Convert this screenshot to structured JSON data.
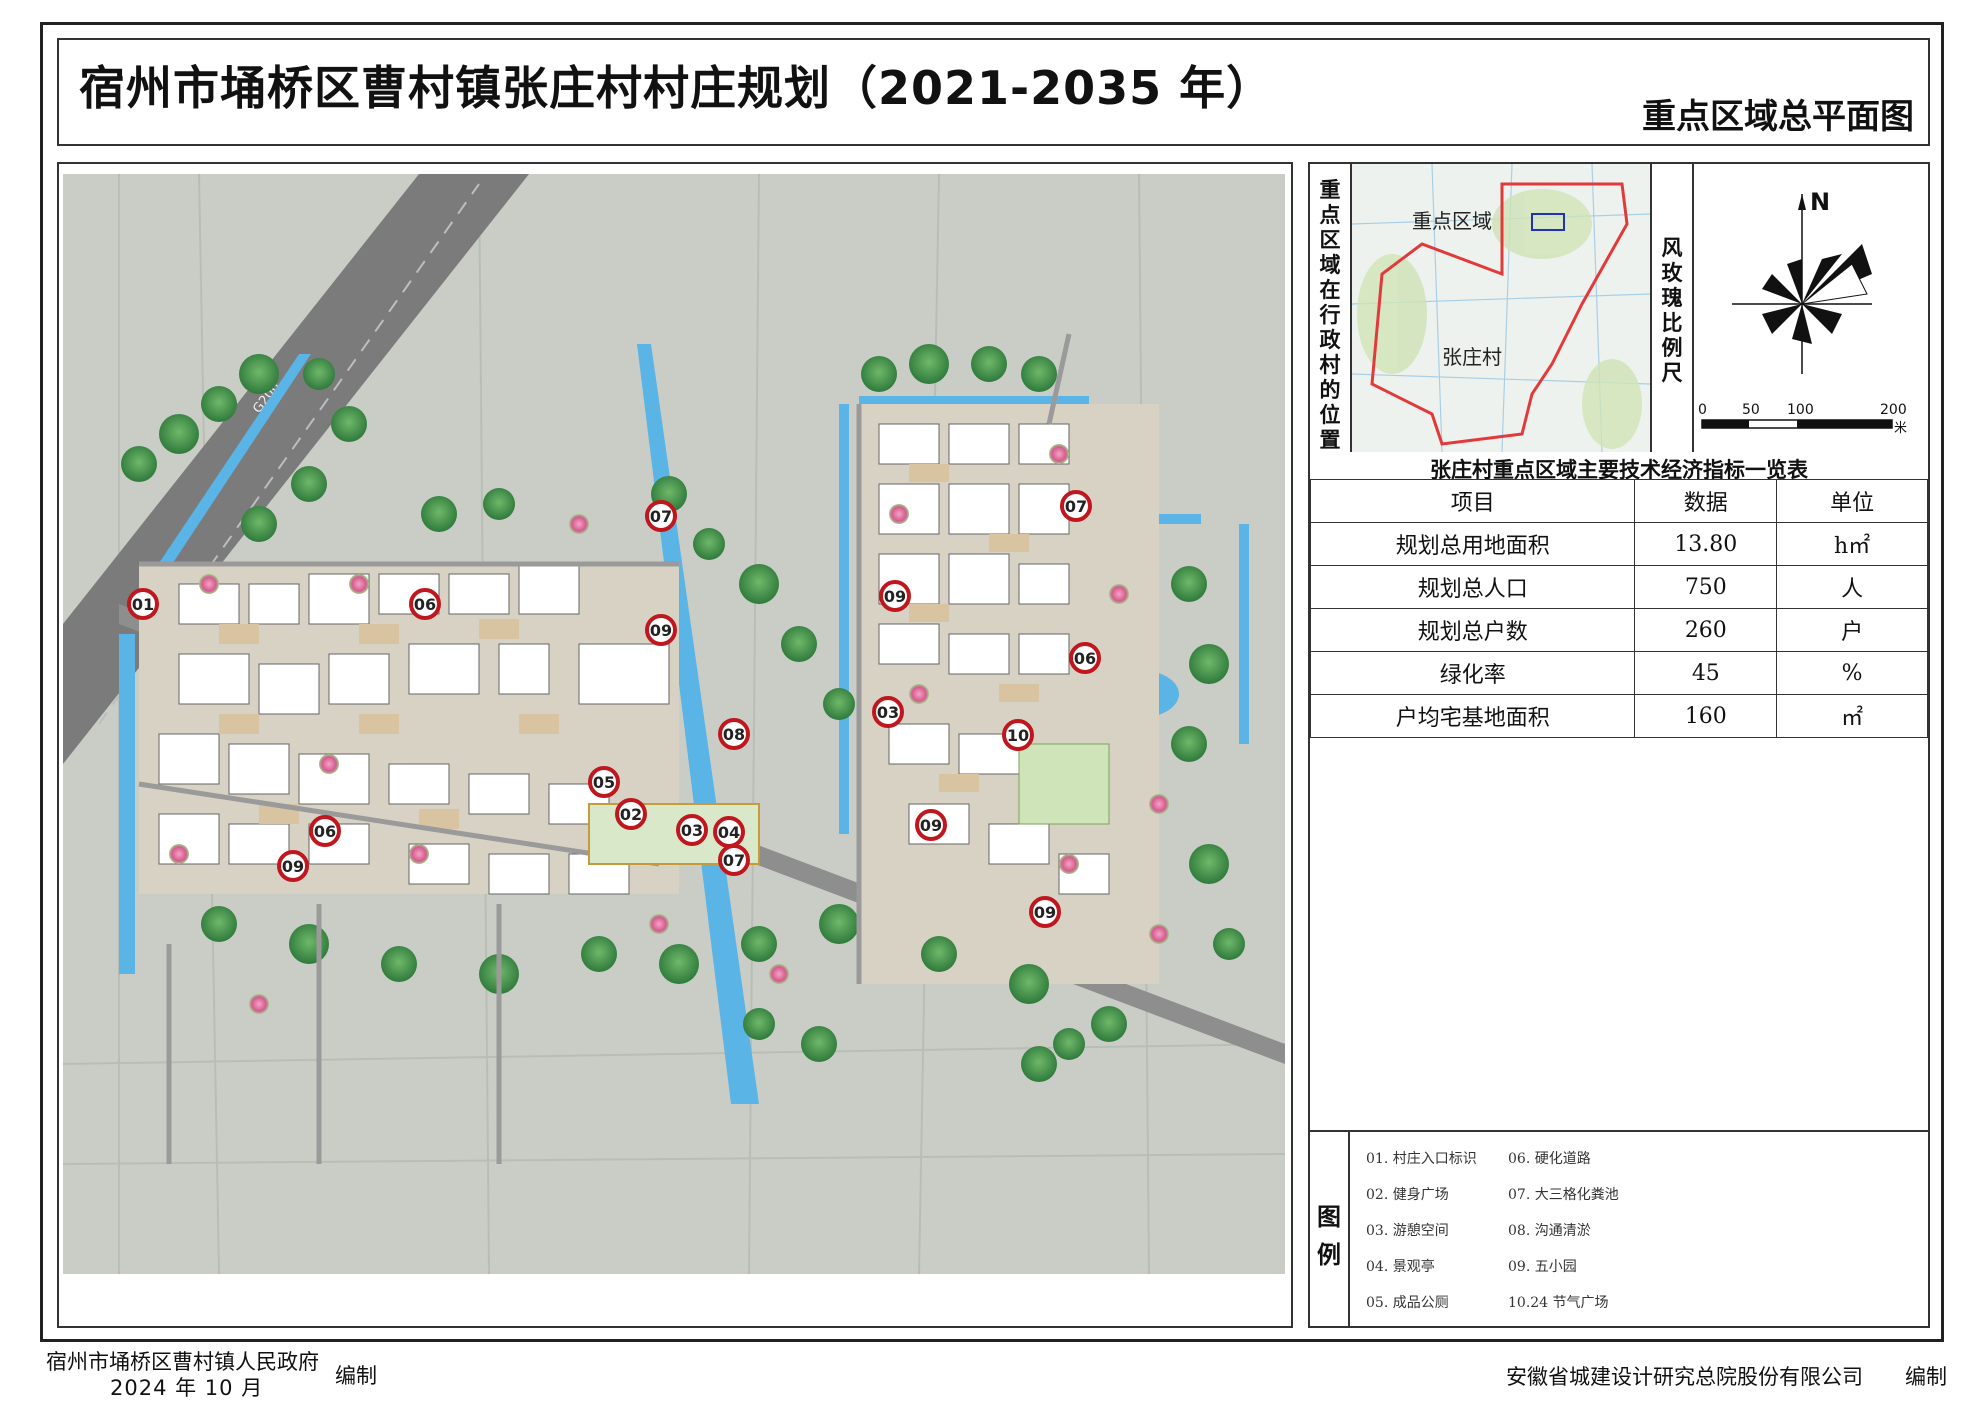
{
  "title": "宿州市埇桥区曹村镇张庄村村庄规划（2021-2035 年）",
  "subtitle": "重点区域总平面图",
  "location_map": {
    "side_label": "重点区域在行政村的位置",
    "focus_label": "重点区域",
    "village_label": "张庄村"
  },
  "wind_rose": {
    "side_label": "风玫瑰比例尺",
    "north": "N",
    "scale_ticks": [
      "0",
      "50",
      "100",
      "200"
    ],
    "scale_unit": "米"
  },
  "road_label": "G206",
  "tech_table": {
    "title": "张庄村重点区域主要技术经济指标一览表",
    "headers": [
      "项目",
      "数据",
      "单位"
    ],
    "rows": [
      [
        "规划总用地面积",
        "13.80",
        "h㎡"
      ],
      [
        "规划总人口",
        "750",
        "人"
      ],
      [
        "规划总户数",
        "260",
        "户"
      ],
      [
        "绿化率",
        "45",
        "%"
      ],
      [
        "户均宅基地面积",
        "160",
        "㎡"
      ]
    ]
  },
  "legend": {
    "title": "图例",
    "items": [
      "01. 村庄入口标识",
      "06. 硬化道路",
      "02. 健身广场",
      "07. 大三格化粪池",
      "03. 游憩空间",
      "08. 沟通清淤",
      "04. 景观亭",
      "09. 五小园",
      "05. 成品公厕",
      "10.24 节气广场"
    ]
  },
  "markers": [
    "01",
    "06",
    "07",
    "09",
    "08",
    "05",
    "02",
    "03",
    "04",
    "07",
    "06",
    "09",
    "07",
    "09",
    "06",
    "03",
    "10",
    "09",
    "09"
  ],
  "footer": {
    "left_org": "宿州市埇桥区曹村镇人民政府",
    "date": "2024 年 10 月",
    "left_edit": "编制",
    "right_org": "安徽省城建设计研究总院股份有限公司",
    "right_edit": "编制"
  },
  "colors": {
    "water": "#5ab4e6",
    "road": "#8a8a8a",
    "building": "#ffffff",
    "building_roof": "#d9c9a8",
    "tree": "#3f8f4a",
    "marker_ring": "#c0161d",
    "boundary": "#e23a3a"
  }
}
